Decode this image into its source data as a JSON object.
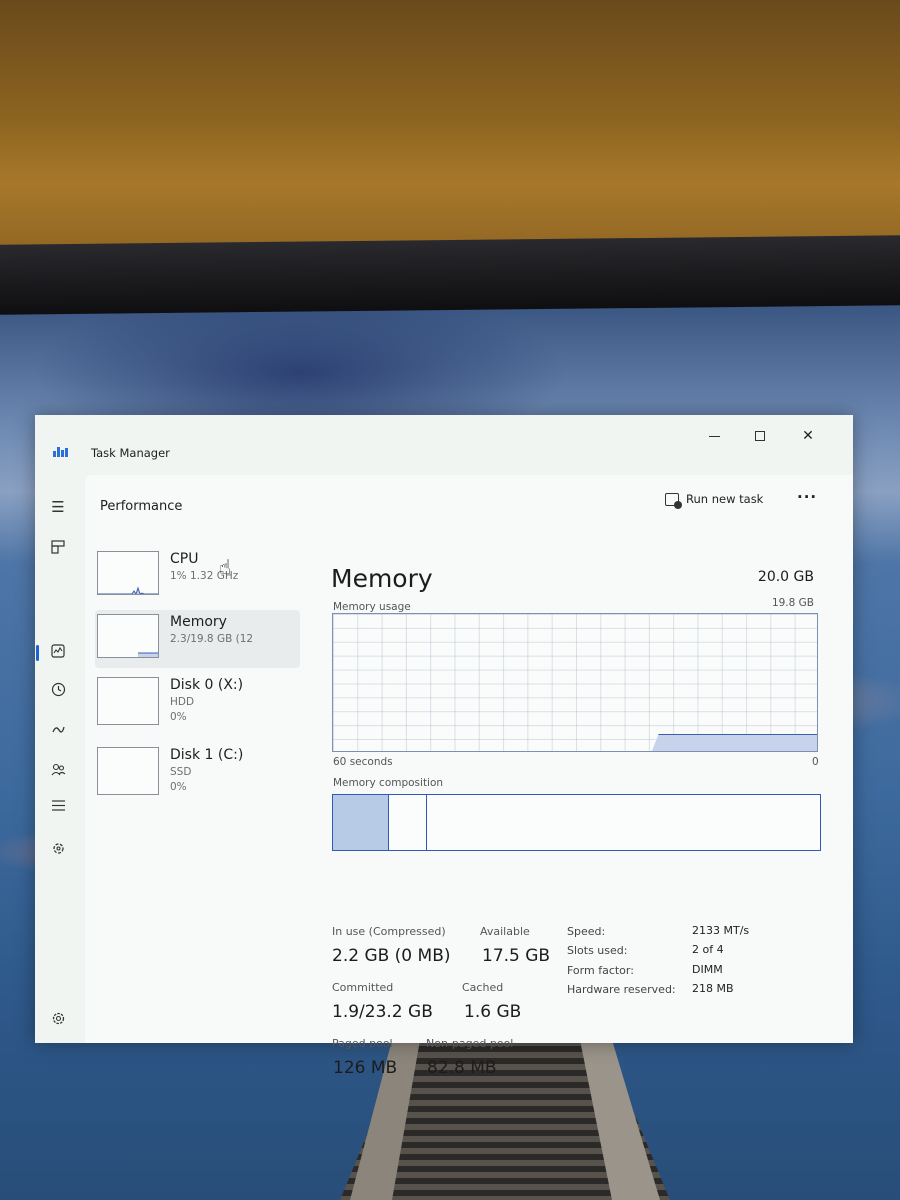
{
  "window": {
    "title": "Task Manager"
  },
  "toolbar": {
    "page_title": "Performance",
    "run_new_task": "Run new task",
    "more": "···"
  },
  "devices": [
    {
      "name": "CPU",
      "line1": "1%  1.32 GHz",
      "line2": ""
    },
    {
      "name": "Memory",
      "line1": "2.3/19.8 GB (12",
      "line2": ""
    },
    {
      "name": "Disk 0 (X:)",
      "line1": "HDD",
      "line2": "0%"
    },
    {
      "name": "Disk 1 (C:)",
      "line1": "SSD",
      "line2": "0%"
    }
  ],
  "memory": {
    "title": "Memory",
    "total": "20.0 GB",
    "usage_label": "Memory usage",
    "usage_max": "19.8 GB",
    "graph_time": "60 seconds",
    "graph_min": "0",
    "composition_label": "Memory composition",
    "stats": {
      "in_use_label": "In use (Compressed)",
      "in_use_value": "2.2 GB (0 MB)",
      "available_label": "Available",
      "available_value": "17.5 GB",
      "committed_label": "Committed",
      "committed_value": "1.9/23.2 GB",
      "cached_label": "Cached",
      "cached_value": "1.6 GB",
      "paged_label": "Paged pool",
      "paged_value": "126 MB",
      "nonpaged_label": "Non-paged pool",
      "nonpaged_value": "82.8 MB"
    },
    "specs": {
      "speed_label": "Speed:",
      "speed_value": "2133 MT/s",
      "slots_label": "Slots used:",
      "slots_value": "2 of 4",
      "form_label": "Form factor:",
      "form_value": "DIMM",
      "hw_label": "Hardware reserved:",
      "hw_value": "218 MB"
    }
  },
  "nav_icons": [
    "hamburger-icon",
    "processes-icon",
    "performance-icon",
    "app-history-icon",
    "startup-apps-icon",
    "users-icon",
    "details-icon",
    "services-icon",
    "settings-icon"
  ],
  "colors": {
    "accent": "#1f62d2",
    "graph_line": "#3d5fb0",
    "graph_fill": "#c6d3ea"
  }
}
